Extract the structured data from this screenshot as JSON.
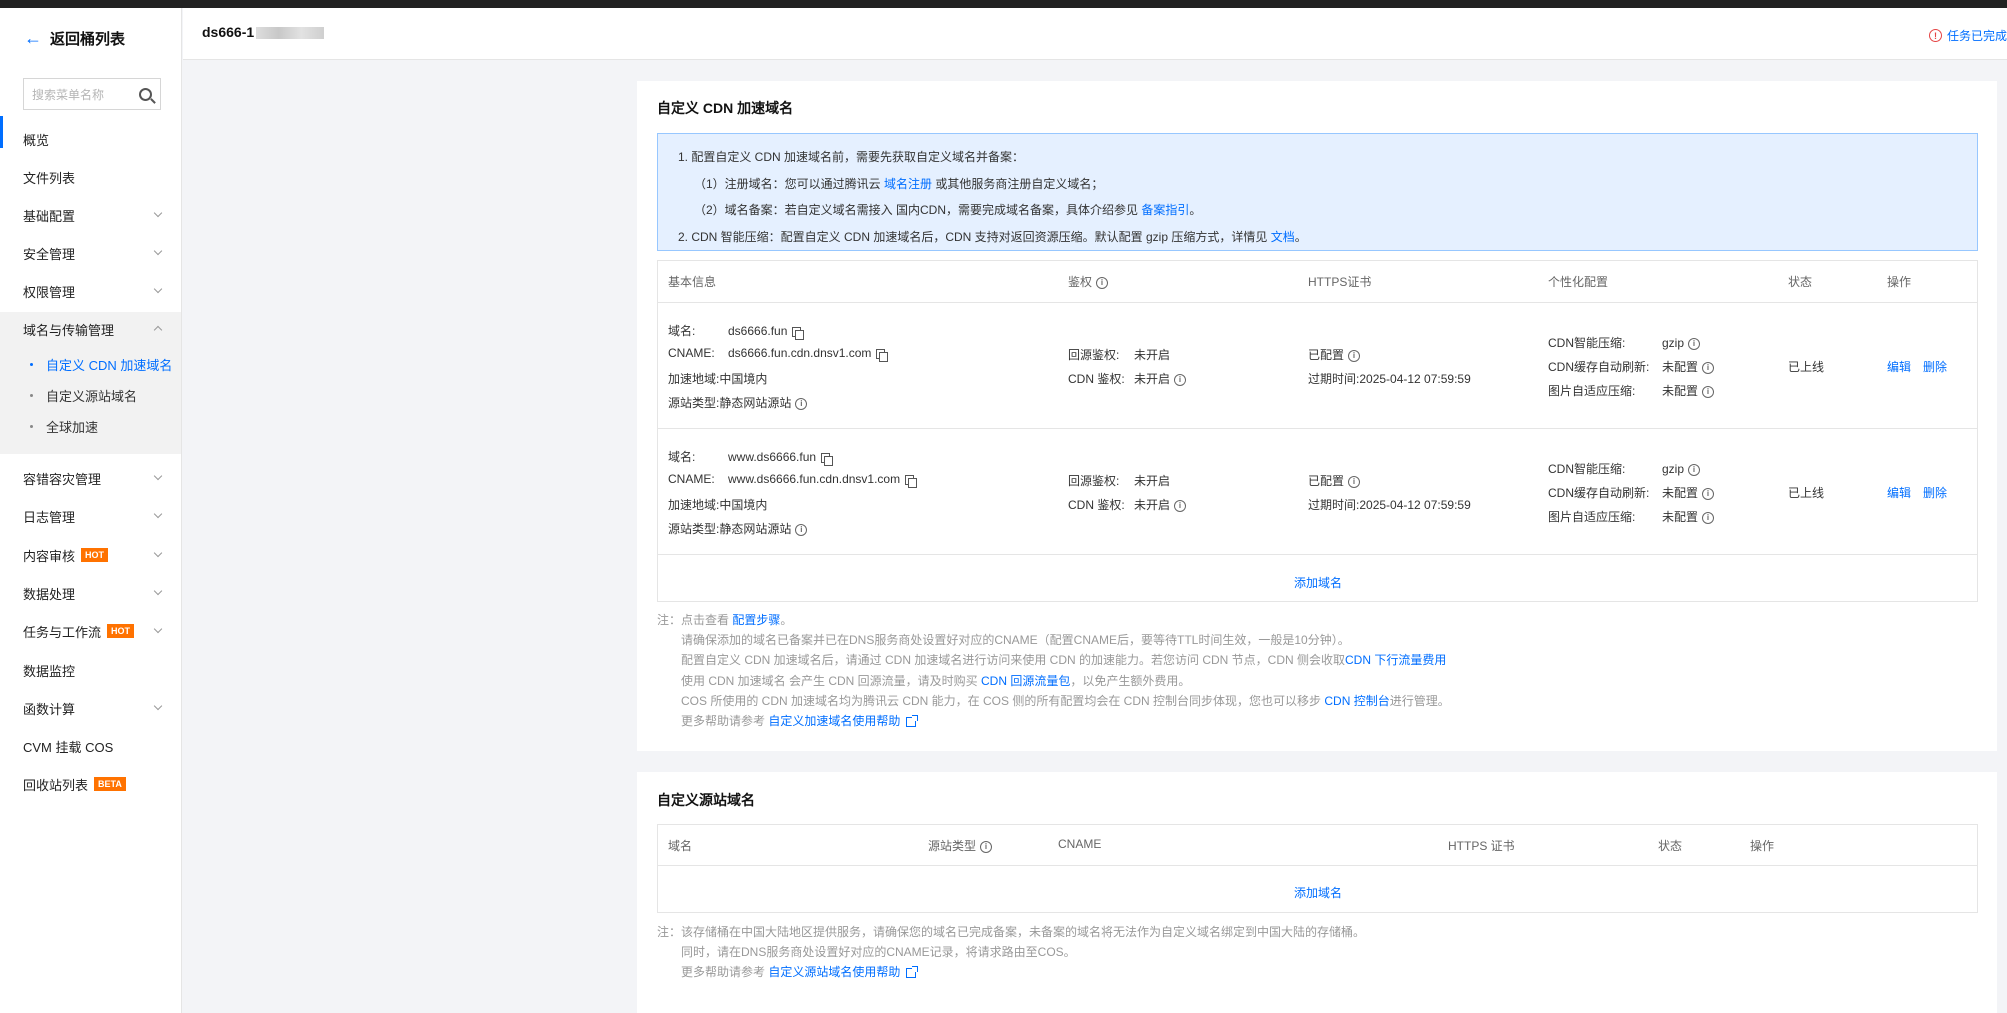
{
  "sidebar": {
    "back_label": "返回桶列表",
    "search_placeholder": "搜索菜单名称",
    "items": [
      {
        "label": "概览"
      },
      {
        "label": "文件列表"
      },
      {
        "label": "基础配置"
      },
      {
        "label": "安全管理"
      },
      {
        "label": "权限管理"
      },
      {
        "label": "域名与传输管理"
      },
      {
        "label": "容错容灾管理"
      },
      {
        "label": "日志管理"
      },
      {
        "label": "内容审核",
        "badge": "HOT"
      },
      {
        "label": "数据处理"
      },
      {
        "label": "任务与工作流",
        "badge": "HOT"
      },
      {
        "label": "数据监控"
      },
      {
        "label": "函数计算"
      },
      {
        "label": "CVM 挂载 COS"
      },
      {
        "label": "回收站列表",
        "badge": "BETA"
      }
    ],
    "sub_items": [
      {
        "label": "自定义 CDN 加速域名"
      },
      {
        "label": "自定义源站域名"
      },
      {
        "label": "全球加速"
      }
    ]
  },
  "header": {
    "bucket_name": "ds666-1",
    "task_status": "任务已完成"
  },
  "cdn_section": {
    "title": "自定义 CDN 加速域名",
    "info_lines": [
      "1. 配置自定义 CDN 加速域名前，需要先获取自定义域名并备案：",
      "（1）注册域名：您可以通过腾讯云 ",
      "域名注册",
      " 或其他服务商注册自定义域名；",
      "（2）域名备案：若自定义域名需接入 国内CDN，需要完成域名备案，具体介绍参见 ",
      "备案指引",
      "。",
      "2. CDN 智能压缩：配置自定义 CDN 加速域名后，CDN 支持对返回资源压缩。默认配置 gzip 压缩方式，详情见 ",
      "文档",
      "。"
    ],
    "columns": [
      "基本信息",
      "鉴权",
      "HTTPS证书",
      "个性化配置",
      "状态",
      "操作"
    ],
    "labels": {
      "domain": "域名:",
      "cname": "CNAME:",
      "region": "加速地域:",
      "origin_type": "源站类型:",
      "origin_auth": "回源鉴权:",
      "cdn_auth": "CDN 鉴权:",
      "expire": "过期时间:",
      "smart_compress": "CDN智能压缩:",
      "cache_refresh": "CDN缓存自动刷新:",
      "image_compress": "图片自适应压缩:"
    },
    "rows": [
      {
        "domain": "ds6666.fun",
        "cname": "ds6666.fun.cdn.dnsv1.com",
        "region": "中国境内",
        "origin_type": "静态网站源站",
        "origin_auth": "未开启",
        "cdn_auth": "未开启",
        "https": "已配置",
        "expire": "2025-04-12 07:59:59",
        "smart_compress": "gzip",
        "cache_refresh": "未配置",
        "image_compress": "未配置",
        "status": "已上线",
        "edit": "编辑",
        "delete": "删除"
      },
      {
        "domain": "www.ds6666.fun",
        "cname": "www.ds6666.fun.cdn.dnsv1.com",
        "region": "中国境内",
        "origin_type": "静态网站源站",
        "origin_auth": "未开启",
        "cdn_auth": "未开启",
        "https": "已配置",
        "expire": "2025-04-12 07:59:59",
        "smart_compress": "gzip",
        "cache_refresh": "未配置",
        "image_compress": "未配置",
        "status": "已上线",
        "edit": "编辑",
        "delete": "删除"
      }
    ],
    "add_label": "添加域名",
    "notes": [
      "注：点击查看 ",
      "配置步骤",
      "。",
      "请确保添加的域名已备案并已在DNS服务商处设置好对应的CNAME（配置CNAME后，要等待TTL时间生效，一般是10分钟）。",
      "配置自定义 CDN 加速域名后，请通过 CDN 加速域名进行访问来使用 CDN 的加速能力。若您访问 CDN 节点，CDN 侧会收取",
      "CDN 下行流量费用",
      "使用 CDN 加速域名 会产生 CDN 回源流量，请及时购买 ",
      "CDN 回源流量包",
      "，以免产生额外费用。",
      "COS 所使用的 CDN 加速域名均为腾讯云 CDN 能力，在 COS 侧的所有配置均会在 CDN 控制台同步体现，您也可以移步 ",
      "CDN 控制台",
      "进行管理。",
      "更多帮助请参考 ",
      "自定义加速域名使用帮助"
    ]
  },
  "origin_section": {
    "title": "自定义源站域名",
    "columns": [
      "域名",
      "源站类型",
      "CNAME",
      "HTTPS 证书",
      "状态",
      "操作"
    ],
    "add_label": "添加域名",
    "notes": [
      "注：该存储桶在中国大陆地区提供服务，请确保您的域名已完成备案，未备案的域名将无法作为自定义域名绑定到中国大陆的存储桶。",
      "同时，请在DNS服务商处设置好对应的CNAME记录，将请求路由至COS。",
      "更多帮助请参考 ",
      "自定义源站域名使用帮助"
    ]
  }
}
